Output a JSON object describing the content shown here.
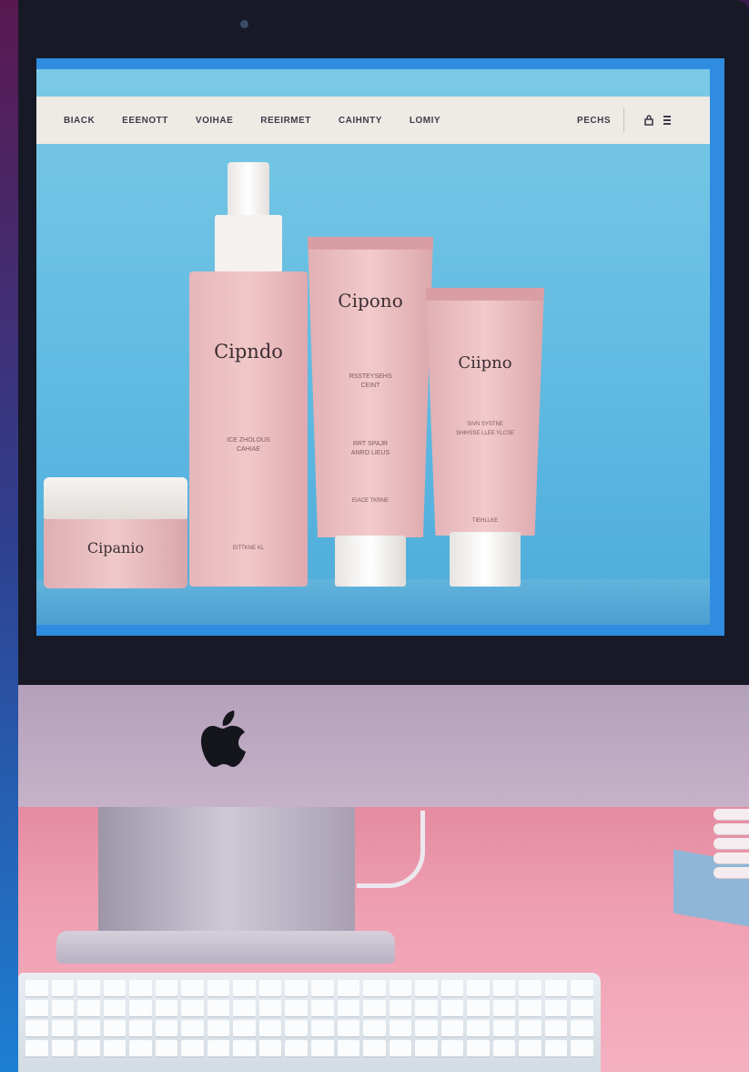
{
  "navbar": {
    "links": [
      "BIACK",
      "EEENOTT",
      "VOIHAE",
      "REEIRMET",
      "CAIHNTY",
      "LOMIY"
    ],
    "right_label": "PECHS",
    "icons": [
      "bag-icon",
      "menu-icon"
    ]
  },
  "products": {
    "bottle": {
      "brand": "Cipndo",
      "desc1": "ICE ZHOLOUS",
      "desc2": "CAHIAE",
      "footer": "EITTKNE KL"
    },
    "tube_large": {
      "brand": "Cipono",
      "desc1": "RSSTEYSEHS",
      "desc2": "CEINT",
      "desc3": "RRT SPAJR",
      "desc4": "ANRO LIEUS",
      "footer": "EIACE   TKRNE"
    },
    "tube_small": {
      "brand": "Ciipno",
      "desc1": "SIVN SYSTNE",
      "desc2": "SHIHSSE LLEE YLCSE",
      "desc3": "TIEHLLKE"
    },
    "jar": {
      "brand": "Cipanio"
    }
  },
  "colors": {
    "screen_bg": "#6bc0e3",
    "navbar_bg": "#eeeae4",
    "product_pink": "#f1c8c8",
    "desk_pink": "#ef9fb2"
  }
}
